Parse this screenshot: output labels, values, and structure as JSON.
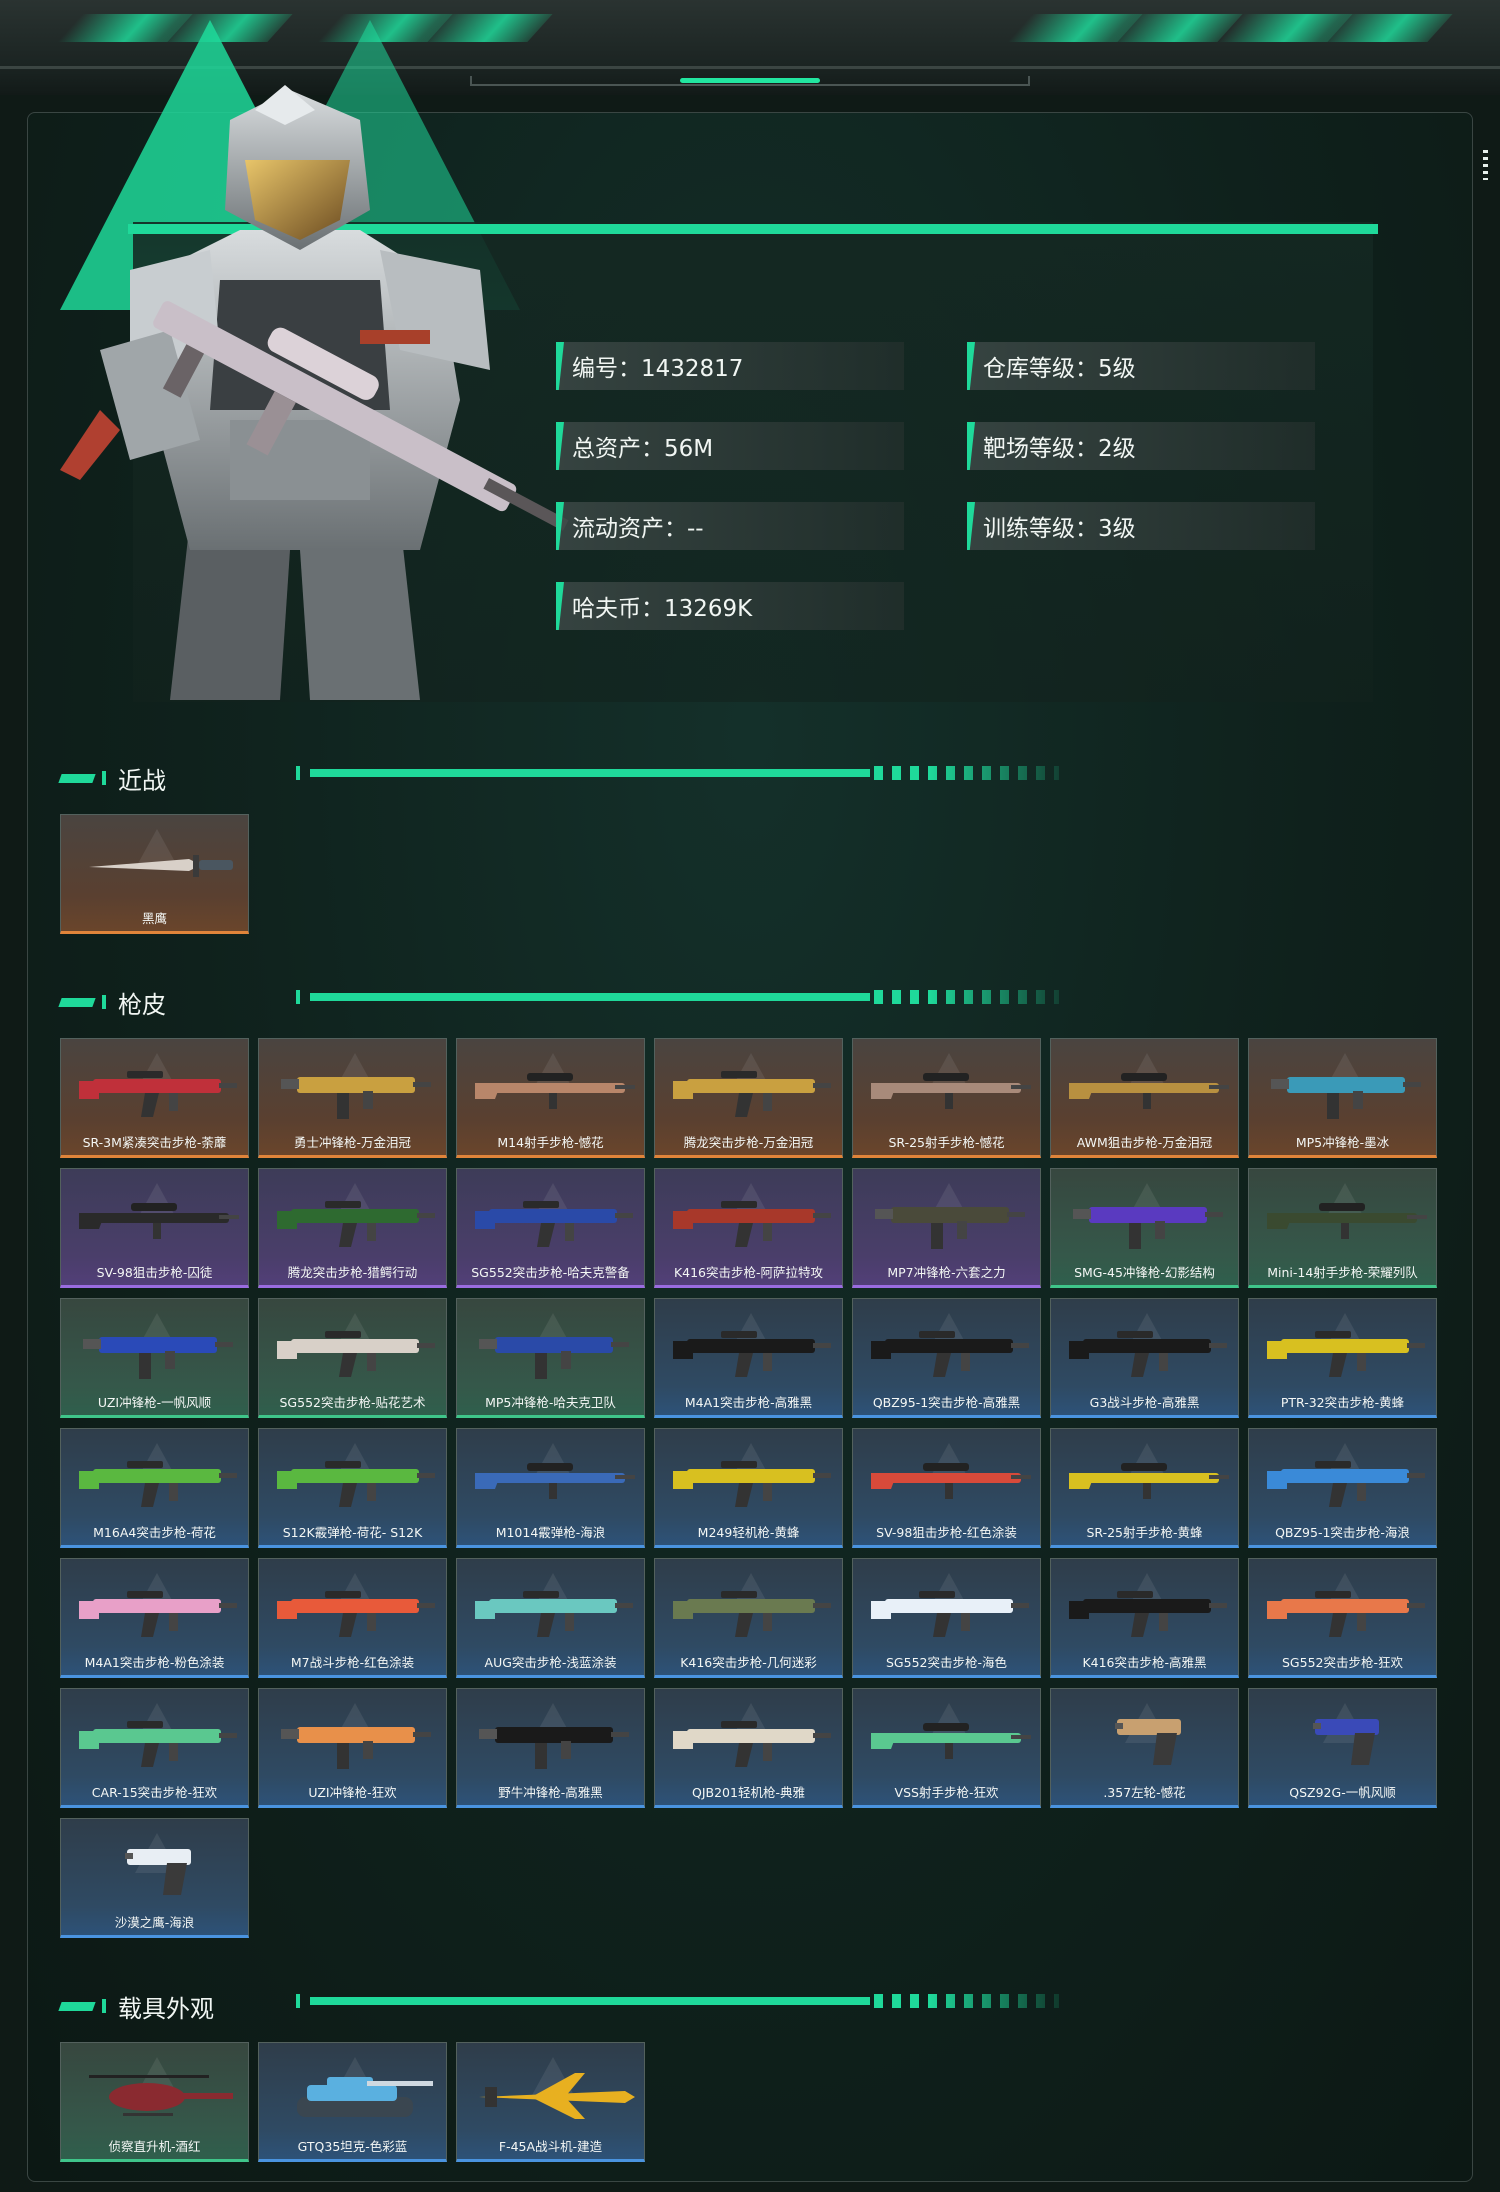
{
  "profile": {
    "stats": [
      {
        "label": "编号：1432817"
      },
      {
        "label": "仓库等级：5级"
      },
      {
        "label": "总资产：56M"
      },
      {
        "label": "靶场等级：2级"
      },
      {
        "label": "流动资产：--"
      },
      {
        "label": "训练等级：3级"
      },
      {
        "label": "哈夫币：13269K"
      }
    ]
  },
  "sections": [
    {
      "title": "近战",
      "items": [
        {
          "name": "黑鹰",
          "rarity": "orange",
          "kind": "knife"
        }
      ]
    },
    {
      "title": "枪皮",
      "items": [
        {
          "name": "SR-3M紧凑突击步枪-荼蘼",
          "rarity": "orange",
          "kind": "rifle",
          "color": "#c0303a"
        },
        {
          "name": "勇士冲锋枪-万金泪冠",
          "rarity": "orange",
          "kind": "smg",
          "color": "#c9a040"
        },
        {
          "name": "M14射手步枪-憾花",
          "rarity": "orange",
          "kind": "sniper",
          "color": "#b8866a"
        },
        {
          "name": "腾龙突击步枪-万金泪冠",
          "rarity": "orange",
          "kind": "rifle",
          "color": "#c9a040"
        },
        {
          "name": "SR-25射手步枪-憾花",
          "rarity": "orange",
          "kind": "sniper",
          "color": "#a88a7a"
        },
        {
          "name": "AWM狙击步枪-万金泪冠",
          "rarity": "orange",
          "kind": "sniper",
          "color": "#b89040"
        },
        {
          "name": "MP5冲锋枪-墨冰",
          "rarity": "orange",
          "kind": "smg",
          "color": "#3a9ab8"
        },
        {
          "name": "SV-98狙击步枪-囚徒",
          "rarity": "purple",
          "kind": "sniper",
          "color": "#2a2a2a"
        },
        {
          "name": "腾龙突击步枪-猎鳄行动",
          "rarity": "purple",
          "kind": "rifle",
          "color": "#2e6a30"
        },
        {
          "name": "SG552突击步枪-哈夫克警备",
          "rarity": "purple",
          "kind": "rifle",
          "color": "#2a4aa8"
        },
        {
          "name": "K416突击步枪-阿萨拉特攻",
          "rarity": "purple",
          "kind": "rifle",
          "color": "#a8382a"
        },
        {
          "name": "MP7冲锋枪-六套之力",
          "rarity": "purple",
          "kind": "smg",
          "color": "#4a4a3a"
        },
        {
          "name": "SMG-45冲锋枪-幻影结构",
          "rarity": "green",
          "kind": "smg",
          "color": "#5a3ac0"
        },
        {
          "name": "Mini-14射手步枪-荣耀列队",
          "rarity": "green",
          "kind": "sniper",
          "color": "#3a4a30"
        },
        {
          "name": "UZI冲锋枪-一帆风顺",
          "rarity": "green",
          "kind": "smg",
          "color": "#2a4ab8"
        },
        {
          "name": "SG552突击步枪-贴花艺术",
          "rarity": "green",
          "kind": "rifle",
          "color": "#d8d0c8"
        },
        {
          "name": "MP5冲锋枪-哈夫克卫队",
          "rarity": "green",
          "kind": "smg",
          "color": "#2a4aa8"
        },
        {
          "name": "M4A1突击步枪-高雅黑",
          "rarity": "blue",
          "kind": "rifle",
          "color": "#1a1a1a"
        },
        {
          "name": "QBZ95-1突击步枪-高雅黑",
          "rarity": "blue",
          "kind": "rifle",
          "color": "#1a1a1a"
        },
        {
          "name": "G3战斗步枪-高雅黑",
          "rarity": "blue",
          "kind": "rifle",
          "color": "#1a1a1a"
        },
        {
          "name": "PTR-32突击步枪-黄蜂",
          "rarity": "blue",
          "kind": "rifle",
          "color": "#d8c020"
        },
        {
          "name": "M16A4突击步枪-荷花",
          "rarity": "blue",
          "kind": "rifle",
          "color": "#5ab840"
        },
        {
          "name": "S12K霰弹枪-荷花- S12K",
          "rarity": "blue",
          "kind": "rifle",
          "color": "#5ab840"
        },
        {
          "name": "M1014霰弹枪-海浪",
          "rarity": "blue",
          "kind": "sniper",
          "color": "#3a6ab8"
        },
        {
          "name": "M249轻机枪-黄蜂",
          "rarity": "blue",
          "kind": "rifle",
          "color": "#d8c020"
        },
        {
          "name": "SV-98狙击步枪-红色涂装",
          "rarity": "blue",
          "kind": "sniper",
          "color": "#d84a3a"
        },
        {
          "name": "SR-25射手步枪-黄蜂",
          "rarity": "blue",
          "kind": "sniper",
          "color": "#d8c020"
        },
        {
          "name": "QBZ95-1突击步枪-海浪",
          "rarity": "blue",
          "kind": "rifle",
          "color": "#3a8ad8"
        },
        {
          "name": "M4A1突击步枪-粉色涂装",
          "rarity": "blue",
          "kind": "rifle",
          "color": "#e8a0c8"
        },
        {
          "name": "M7战斗步枪-红色涂装",
          "rarity": "blue",
          "kind": "rifle",
          "color": "#e85a3a"
        },
        {
          "name": "AUG突击步枪-浅蓝涂装",
          "rarity": "blue",
          "kind": "rifle",
          "color": "#6ac8c0"
        },
        {
          "name": "K416突击步枪-几何迷彩",
          "rarity": "blue",
          "kind": "rifle",
          "color": "#6a7a50"
        },
        {
          "name": "SG552突击步枪-海色",
          "rarity": "blue",
          "kind": "rifle",
          "color": "#e8f0f8"
        },
        {
          "name": "K416突击步枪-高雅黑",
          "rarity": "blue",
          "kind": "rifle",
          "color": "#1a1a1a"
        },
        {
          "name": "SG552突击步枪-狂欢",
          "rarity": "blue",
          "kind": "rifle",
          "color": "#e8784a"
        },
        {
          "name": "CAR-15突击步枪-狂欢",
          "rarity": "blue",
          "kind": "rifle",
          "color": "#5ac890"
        },
        {
          "name": "UZI冲锋枪-狂欢",
          "rarity": "blue",
          "kind": "smg",
          "color": "#e8904a"
        },
        {
          "name": "野牛冲锋枪-高雅黑",
          "rarity": "blue",
          "kind": "smg",
          "color": "#1a1a1a"
        },
        {
          "name": "QJB201轻机枪-典雅",
          "rarity": "blue",
          "kind": "rifle",
          "color": "#e0d8c8"
        },
        {
          "name": "VSS射手步枪-狂欢",
          "rarity": "blue",
          "kind": "sniper",
          "color": "#5ac890"
        },
        {
          "name": ".357左轮-憾花",
          "rarity": "blue",
          "kind": "pistol",
          "color": "#c8a070"
        },
        {
          "name": "QSZ92G-一帆风顺",
          "rarity": "blue",
          "kind": "pistol",
          "color": "#3a4ab8"
        },
        {
          "name": "沙漠之鹰-海浪",
          "rarity": "blue",
          "kind": "pistol",
          "color": "#e8eef4"
        }
      ]
    },
    {
      "title": "载具外观",
      "items": [
        {
          "name": "侦察直升机-酒红",
          "rarity": "green",
          "kind": "heli",
          "color": "#8a2a30"
        },
        {
          "name": "GTQ35坦克-色彩蓝",
          "rarity": "blue",
          "kind": "tank",
          "color": "#5ab0e0"
        },
        {
          "name": "F-45A战斗机-建造",
          "rarity": "blue",
          "kind": "jet",
          "color": "#e8b020"
        }
      ]
    }
  ]
}
